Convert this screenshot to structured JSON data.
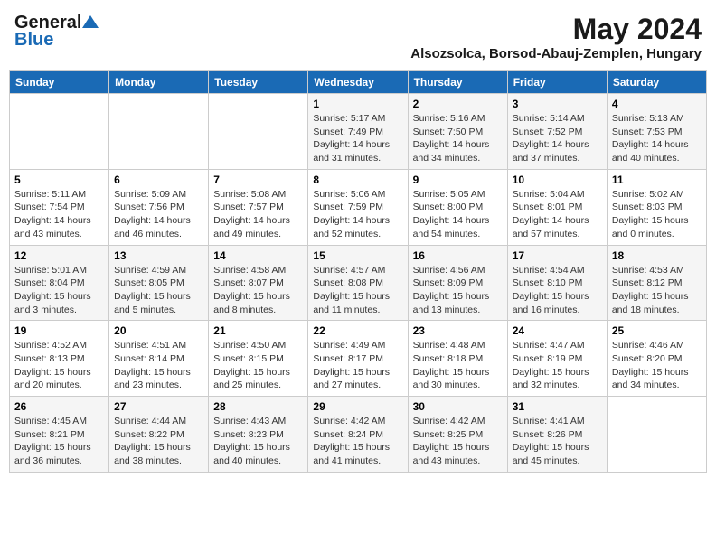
{
  "header": {
    "logo_general": "General",
    "logo_blue": "Blue",
    "month_title": "May 2024",
    "subtitle": "Alsozsolca, Borsod-Abauj-Zemplen, Hungary"
  },
  "weekdays": [
    "Sunday",
    "Monday",
    "Tuesday",
    "Wednesday",
    "Thursday",
    "Friday",
    "Saturday"
  ],
  "weeks": [
    [
      {
        "day": "",
        "info": ""
      },
      {
        "day": "",
        "info": ""
      },
      {
        "day": "",
        "info": ""
      },
      {
        "day": "1",
        "info": "Sunrise: 5:17 AM\nSunset: 7:49 PM\nDaylight: 14 hours\nand 31 minutes."
      },
      {
        "day": "2",
        "info": "Sunrise: 5:16 AM\nSunset: 7:50 PM\nDaylight: 14 hours\nand 34 minutes."
      },
      {
        "day": "3",
        "info": "Sunrise: 5:14 AM\nSunset: 7:52 PM\nDaylight: 14 hours\nand 37 minutes."
      },
      {
        "day": "4",
        "info": "Sunrise: 5:13 AM\nSunset: 7:53 PM\nDaylight: 14 hours\nand 40 minutes."
      }
    ],
    [
      {
        "day": "5",
        "info": "Sunrise: 5:11 AM\nSunset: 7:54 PM\nDaylight: 14 hours\nand 43 minutes."
      },
      {
        "day": "6",
        "info": "Sunrise: 5:09 AM\nSunset: 7:56 PM\nDaylight: 14 hours\nand 46 minutes."
      },
      {
        "day": "7",
        "info": "Sunrise: 5:08 AM\nSunset: 7:57 PM\nDaylight: 14 hours\nand 49 minutes."
      },
      {
        "day": "8",
        "info": "Sunrise: 5:06 AM\nSunset: 7:59 PM\nDaylight: 14 hours\nand 52 minutes."
      },
      {
        "day": "9",
        "info": "Sunrise: 5:05 AM\nSunset: 8:00 PM\nDaylight: 14 hours\nand 54 minutes."
      },
      {
        "day": "10",
        "info": "Sunrise: 5:04 AM\nSunset: 8:01 PM\nDaylight: 14 hours\nand 57 minutes."
      },
      {
        "day": "11",
        "info": "Sunrise: 5:02 AM\nSunset: 8:03 PM\nDaylight: 15 hours\nand 0 minutes."
      }
    ],
    [
      {
        "day": "12",
        "info": "Sunrise: 5:01 AM\nSunset: 8:04 PM\nDaylight: 15 hours\nand 3 minutes."
      },
      {
        "day": "13",
        "info": "Sunrise: 4:59 AM\nSunset: 8:05 PM\nDaylight: 15 hours\nand 5 minutes."
      },
      {
        "day": "14",
        "info": "Sunrise: 4:58 AM\nSunset: 8:07 PM\nDaylight: 15 hours\nand 8 minutes."
      },
      {
        "day": "15",
        "info": "Sunrise: 4:57 AM\nSunset: 8:08 PM\nDaylight: 15 hours\nand 11 minutes."
      },
      {
        "day": "16",
        "info": "Sunrise: 4:56 AM\nSunset: 8:09 PM\nDaylight: 15 hours\nand 13 minutes."
      },
      {
        "day": "17",
        "info": "Sunrise: 4:54 AM\nSunset: 8:10 PM\nDaylight: 15 hours\nand 16 minutes."
      },
      {
        "day": "18",
        "info": "Sunrise: 4:53 AM\nSunset: 8:12 PM\nDaylight: 15 hours\nand 18 minutes."
      }
    ],
    [
      {
        "day": "19",
        "info": "Sunrise: 4:52 AM\nSunset: 8:13 PM\nDaylight: 15 hours\nand 20 minutes."
      },
      {
        "day": "20",
        "info": "Sunrise: 4:51 AM\nSunset: 8:14 PM\nDaylight: 15 hours\nand 23 minutes."
      },
      {
        "day": "21",
        "info": "Sunrise: 4:50 AM\nSunset: 8:15 PM\nDaylight: 15 hours\nand 25 minutes."
      },
      {
        "day": "22",
        "info": "Sunrise: 4:49 AM\nSunset: 8:17 PM\nDaylight: 15 hours\nand 27 minutes."
      },
      {
        "day": "23",
        "info": "Sunrise: 4:48 AM\nSunset: 8:18 PM\nDaylight: 15 hours\nand 30 minutes."
      },
      {
        "day": "24",
        "info": "Sunrise: 4:47 AM\nSunset: 8:19 PM\nDaylight: 15 hours\nand 32 minutes."
      },
      {
        "day": "25",
        "info": "Sunrise: 4:46 AM\nSunset: 8:20 PM\nDaylight: 15 hours\nand 34 minutes."
      }
    ],
    [
      {
        "day": "26",
        "info": "Sunrise: 4:45 AM\nSunset: 8:21 PM\nDaylight: 15 hours\nand 36 minutes."
      },
      {
        "day": "27",
        "info": "Sunrise: 4:44 AM\nSunset: 8:22 PM\nDaylight: 15 hours\nand 38 minutes."
      },
      {
        "day": "28",
        "info": "Sunrise: 4:43 AM\nSunset: 8:23 PM\nDaylight: 15 hours\nand 40 minutes."
      },
      {
        "day": "29",
        "info": "Sunrise: 4:42 AM\nSunset: 8:24 PM\nDaylight: 15 hours\nand 41 minutes."
      },
      {
        "day": "30",
        "info": "Sunrise: 4:42 AM\nSunset: 8:25 PM\nDaylight: 15 hours\nand 43 minutes."
      },
      {
        "day": "31",
        "info": "Sunrise: 4:41 AM\nSunset: 8:26 PM\nDaylight: 15 hours\nand 45 minutes."
      },
      {
        "day": "",
        "info": ""
      }
    ]
  ]
}
